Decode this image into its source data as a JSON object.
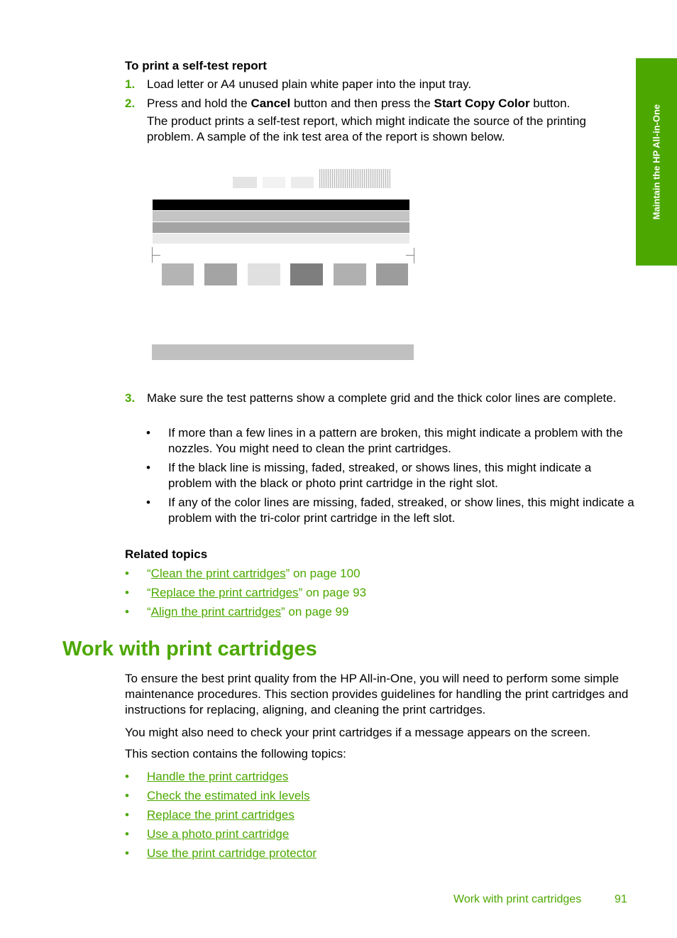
{
  "side_tab": {
    "label": "Maintain the HP All-in-One",
    "color": "#4ca800"
  },
  "procedure": {
    "heading": "To print a self-test report",
    "steps": [
      {
        "num": "1.",
        "text": "Load letter or A4 unused plain white paper into the input tray."
      },
      {
        "num": "2.",
        "text_a": "Press and hold the ",
        "bold_a": "Cancel",
        "text_b": " button and then press the ",
        "bold_b": "Start Copy Color",
        "text_c": " button.",
        "detail": "The product prints a self-test report, which might indicate the source of the printing problem. A sample of the ink test area of the report is shown below."
      },
      {
        "num": "3.",
        "text": "Make sure the test patterns show a complete grid and the thick color lines are complete."
      }
    ],
    "step3_bullets": [
      "If more than a few lines in a pattern are broken, this might indicate a problem with the nozzles. You might need to clean the print cartridges.",
      "If the black line is missing, faded, streaked, or shows lines, this might indicate a problem with the black or photo print cartridge in the right slot.",
      "If any of the color lines are missing, faded, streaked, or show lines, this might indicate a problem with the tri-color print cartridge in the left slot."
    ]
  },
  "figure": {
    "alt": "Sample ink test area of self-test report"
  },
  "related": {
    "heading": "Related topics",
    "items": [
      {
        "link": "Clean the print cartridges",
        "suffix": "” on page 100"
      },
      {
        "link": "Replace the print cartridges",
        "suffix": "” on page 93"
      },
      {
        "link": "Align the print cartridges",
        "suffix": "” on page 99"
      }
    ]
  },
  "section": {
    "title": "Work with print cartridges",
    "para1": "To ensure the best print quality from the HP All-in-One, you will need to perform some simple maintenance procedures. This section provides guidelines for handling the print cartridges and instructions for replacing, aligning, and cleaning the print cartridges.",
    "para2": "You might also need to check your print cartridges if a message appears on the screen.",
    "para3": "This section contains the following topics:",
    "topics": [
      "Handle the print cartridges",
      "Check the estimated ink levels",
      "Replace the print cartridges",
      "Use a photo print cartridge",
      "Use the print cartridge protector"
    ]
  },
  "footer": {
    "title": "Work with print cartridges",
    "page": "91"
  },
  "bullet_char": "•",
  "open_quote": "“"
}
